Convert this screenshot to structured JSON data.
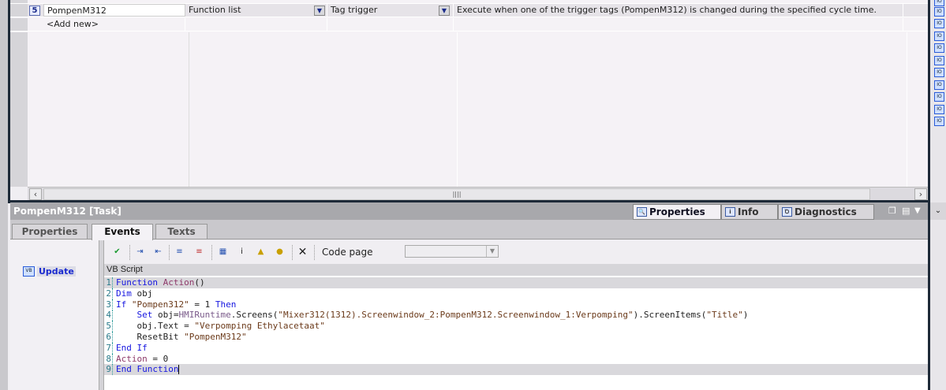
{
  "table": {
    "rows": [
      {
        "number": "5",
        "name": "PompenM312",
        "type": "Function list",
        "trigger": "Tag trigger",
        "description": "Execute when one of the trigger tags (PompenM312)  is changed during the specified cycle time."
      }
    ],
    "add_new": "<Add new>"
  },
  "inspector": {
    "title": "PompenM312 [Task]",
    "panel_tabs": [
      {
        "label": "Properties",
        "icon": "properties-icon"
      },
      {
        "label": "Info",
        "icon": "info-icon"
      },
      {
        "label": "Diagnostics",
        "icon": "diagnostics-icon"
      }
    ],
    "tabs": [
      "Properties",
      "Events",
      "Texts"
    ],
    "active_tab": "Events",
    "events": [
      {
        "label": "Update",
        "icon": "vb-script-icon"
      }
    ],
    "toolbar": {
      "code_page_label": "Code page",
      "code_page_value": ""
    },
    "script_header": "VB Script",
    "code_lines": [
      [
        {
          "t": "Function ",
          "c": "kw"
        },
        {
          "t": "Action",
          "c": "fn"
        },
        {
          "t": "()",
          "c": ""
        }
      ],
      [
        {
          "t": "Dim ",
          "c": "kw"
        },
        {
          "t": "obj",
          "c": ""
        }
      ],
      [
        {
          "t": "If ",
          "c": "kw"
        },
        {
          "t": "\"Pompen312\"",
          "c": "st"
        },
        {
          "t": " = 1 ",
          "c": ""
        },
        {
          "t": "Then",
          "c": "kw"
        }
      ],
      [
        {
          "t": "    Set ",
          "c": "kw"
        },
        {
          "t": "obj=",
          "c": ""
        },
        {
          "t": "HMIRuntime",
          "c": "ob"
        },
        {
          "t": ".Screens(",
          "c": ""
        },
        {
          "t": "\"Mixer312(1312).Screenwindow_2:PompenM312.Screenwindow_1:Verpomping\"",
          "c": "st"
        },
        {
          "t": ").ScreenItems(",
          "c": ""
        },
        {
          "t": "\"Title\"",
          "c": "st"
        },
        {
          "t": ")",
          "c": ""
        }
      ],
      [
        {
          "t": "    obj.Text = ",
          "c": ""
        },
        {
          "t": "\"Verpomping Ethylacetaat\"",
          "c": "st"
        }
      ],
      [
        {
          "t": "    ResetBit ",
          "c": ""
        },
        {
          "t": "\"PompenM312\"",
          "c": "st"
        }
      ],
      [
        {
          "t": "End If",
          "c": "kw"
        }
      ],
      [
        {
          "t": "Action",
          "c": "fn"
        },
        {
          "t": " = 0",
          "c": ""
        }
      ],
      [
        {
          "t": "End Function",
          "c": "kw"
        }
      ]
    ]
  },
  "colors": {
    "title_bar": "#a8a8ac",
    "border": "#1e2a38",
    "keyword": "#1515e0"
  }
}
